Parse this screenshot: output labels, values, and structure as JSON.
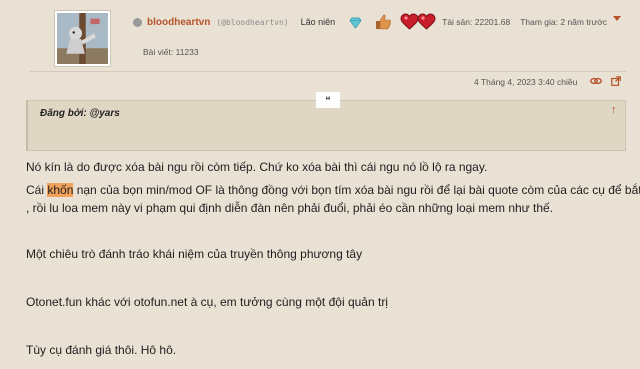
{
  "author": {
    "username": "bloodheartvn",
    "handle": "(@bloodheartvn)",
    "rank": "Lão niên",
    "assets": "Tài sản: 22201.68",
    "joined": "Tham gia: 2 năm trước",
    "post_count": "Bài viết: 11233"
  },
  "post_meta": {
    "date": "4 Tháng 4, 2023 3:40 chiều"
  },
  "quote": {
    "mark": "“",
    "label": "Đăng bởi: @yars",
    "jump": "↑"
  },
  "body": {
    "p1": "Nó kín là do được xóa bài ngu rồi còm tiếp. Chứ ko xóa bài thì cái ngu nó lồ lộ ra ngay.",
    "p2_pre": "Cái ",
    "p2_highlight": "khốn",
    "p2_post": " nạn của bọn min/mod OF là thông đồng với bọn tím xóa bài ngu rồi để lại bài quote còm của các cụ để bắt lỗi",
    "p2_line2": ", rồi lu loa mem này vi phạm qui định diễn đàn nên phải đuổi, phải éo cần những loại mem như thế.",
    "p3": "Một chiêu trò đánh tráo khái niệm của truyền thông phương tây",
    "p4": "Otonet.fun khác với otofun.net à cụ, em tưởng cùng một đội quản trị",
    "p5": "Tùy cụ đánh giá thôi. Hô hô."
  },
  "colors": {
    "background": "#e9e1d3",
    "username": "#b5542a",
    "highlight": "#f2a15a",
    "quote_bg": "#e0d6c4"
  },
  "icons": [
    "status-dot-icon",
    "diamond-icon",
    "thumbs-up-icon",
    "heart-icon",
    "heart-icon",
    "menu-caret-icon",
    "link-icon",
    "share-icon",
    "arrow-up-icon"
  ]
}
